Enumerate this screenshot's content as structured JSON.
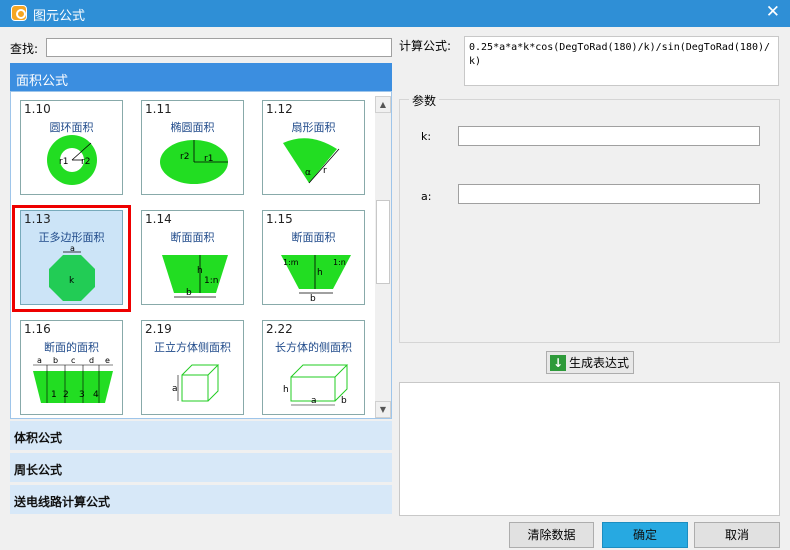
{
  "window": {
    "title": "图元公式",
    "close": "✕"
  },
  "search": {
    "label": "查找:",
    "value": ""
  },
  "formula": {
    "label": "计算公式:",
    "value": "0.25*a*a*k*cos(DegToRad(180)/k)/sin(DegToRad(180)/k)"
  },
  "params": {
    "legend": "参数",
    "items": [
      {
        "label": "k:",
        "value": ""
      },
      {
        "label": "a:",
        "value": ""
      }
    ]
  },
  "generate_button": "生成表达式",
  "panel": {
    "header": "面积公式",
    "cards": [
      {
        "num": "1.10",
        "name": "圆环面积",
        "icon": "ring-icon",
        "labels": [
          "r1",
          "r2"
        ]
      },
      {
        "num": "1.11",
        "name": "椭圆面积",
        "icon": "ellipse-icon",
        "labels": [
          "r2",
          "r1"
        ]
      },
      {
        "num": "1.12",
        "name": "扇形面积",
        "icon": "sector-icon",
        "labels": [
          "α",
          "r"
        ]
      },
      {
        "num": "1.13",
        "name": "正多边形面积",
        "icon": "polygon-icon",
        "labels": [
          "a",
          "k"
        ]
      },
      {
        "num": "1.14",
        "name": "断面面积",
        "icon": "section-icon",
        "labels": [
          "h",
          "1:n",
          "b"
        ]
      },
      {
        "num": "1.15",
        "name": "断面面积",
        "icon": "section2-icon",
        "labels": [
          "1:m",
          "1:n",
          "h",
          "b"
        ]
      },
      {
        "num": "1.16",
        "name": "断面的面积",
        "icon": "multi-section-icon",
        "labels": [
          "a",
          "b",
          "c",
          "d",
          "e",
          "1",
          "2",
          "3",
          "4"
        ]
      },
      {
        "num": "2.19",
        "name": "正立方体侧面积",
        "icon": "cube-icon",
        "labels": [
          "a"
        ]
      },
      {
        "num": "2.22",
        "name": "长方体的侧面积",
        "icon": "cuboid-icon",
        "labels": [
          "h",
          "a",
          "b"
        ]
      }
    ]
  },
  "categories": [
    "体积公式",
    "周长公式",
    "送电线路计算公式"
  ],
  "buttons": {
    "clear": "清除数据",
    "ok": "确定",
    "cancel": "取消"
  },
  "colors": {
    "accent": "#3b8ee0",
    "shape_fill": "#22dd22",
    "selection": "#ee0000"
  }
}
